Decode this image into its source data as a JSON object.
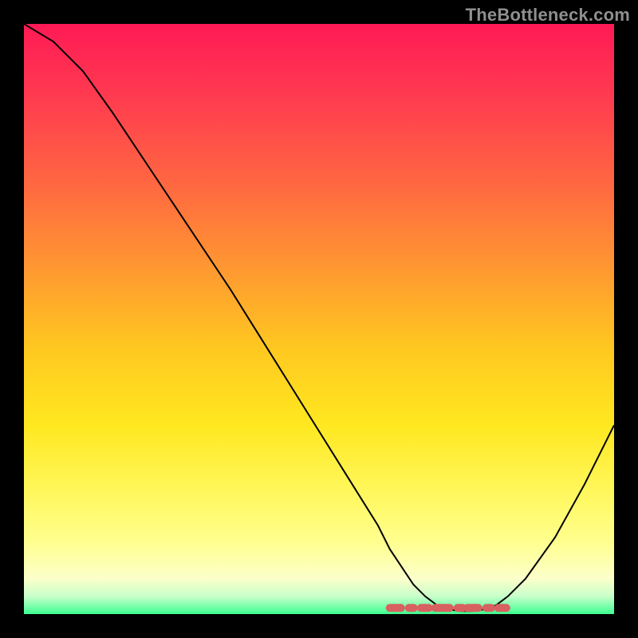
{
  "watermark": "TheBottleneck.com",
  "chart_data": {
    "type": "line",
    "title": "",
    "xlabel": "",
    "ylabel": "",
    "xlim": [
      0,
      100
    ],
    "ylim": [
      0,
      100
    ],
    "x": [
      0,
      5,
      10,
      15,
      20,
      25,
      30,
      35,
      40,
      45,
      50,
      55,
      60,
      62,
      64,
      66,
      68,
      70,
      72,
      74,
      76,
      78,
      80,
      82,
      85,
      90,
      95,
      100
    ],
    "values": [
      100,
      97,
      92,
      85,
      77.5,
      70,
      62.5,
      55,
      47,
      39,
      31,
      23,
      15,
      11,
      8,
      5,
      3,
      1.5,
      0.8,
      0.5,
      0.5,
      0.8,
      1.5,
      3,
      6,
      13,
      22,
      32
    ],
    "min_region": {
      "x_start": 62,
      "x_end": 82,
      "y": 0.5
    },
    "gradient_colors": {
      "top": "#ff1a55",
      "mid": "#ffe820",
      "bottom": "#3cff90"
    },
    "annotations": []
  }
}
